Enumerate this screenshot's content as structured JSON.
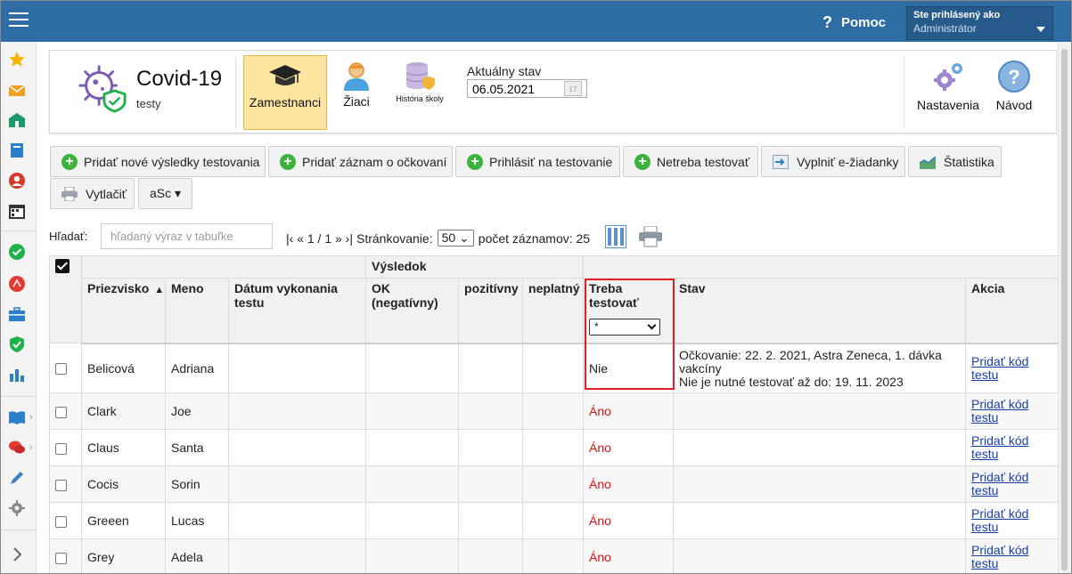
{
  "topbar": {
    "help_label": "Pomoc",
    "user_line1": "Ste prihlásený ako",
    "user_line2": "Administrátor"
  },
  "app": {
    "title": "Covid-19",
    "subtitle": "testy"
  },
  "tabs": [
    {
      "label": "Zamestnanci",
      "active": true
    },
    {
      "label": "Žiaci"
    },
    {
      "label": "História školy"
    }
  ],
  "state": {
    "label": "Aktuálny stav",
    "date": "06.05.2021"
  },
  "header_right": {
    "settings": "Nastavenia",
    "guide": "Návod"
  },
  "toolbar": {
    "add_results": "Pridať nové výsledky testovania",
    "add_vaccination": "Pridať záznam o očkovaní",
    "register_testing": "Prihlásiť na testovanie",
    "no_test_needed": "Netreba testovať",
    "fill_eforms": "Vyplniť e-žiadanky",
    "statistics": "Štatistika",
    "print": "Vytlačiť",
    "asc": "aSc ▾"
  },
  "search": {
    "label": "Hľadať:",
    "placeholder": "hľadaný výraz v tabuľke"
  },
  "pager": {
    "nav": "|‹ « 1 / 1 » ›|",
    "paging_label": "Stránkovanie:",
    "page_size": "50",
    "count_text": "počet záznamov: 25"
  },
  "table": {
    "group_header": "Výsledok",
    "columns": {
      "surname": "Priezvisko",
      "name": "Meno",
      "date": "Dátum vykonania testu",
      "ok": "OK (negatívny)",
      "positive": "pozitívny",
      "invalid": "neplatný",
      "need_test": "Treba testovať",
      "status": "Stav",
      "action": "Akcia"
    },
    "filter_value": "*",
    "rows": [
      {
        "surname": "Belicová",
        "name": "Adriana",
        "need": "Nie",
        "status1": "Očkovanie: 22. 2. 2021, Astra Zeneca, 1. dávka vakcíny",
        "status2": "Nie je nutné testovať až do: 19. 11. 2023",
        "action1": "Pridať kód",
        "action2": "testu"
      },
      {
        "surname": "Clark",
        "name": "Joe",
        "need": "Áno",
        "status1": "",
        "status2": "",
        "action1": "Pridať kód",
        "action2": "testu"
      },
      {
        "surname": "Claus",
        "name": "Santa",
        "need": "Áno",
        "status1": "",
        "status2": "",
        "action1": "Pridať kód",
        "action2": "testu"
      },
      {
        "surname": "Cocis",
        "name": "Sorin",
        "need": "Áno",
        "status1": "",
        "status2": "",
        "action1": "Pridať kód",
        "action2": "testu"
      },
      {
        "surname": "Greeen",
        "name": "Lucas",
        "need": "Áno",
        "status1": "",
        "status2": "",
        "action1": "Pridať kód",
        "action2": "testu"
      },
      {
        "surname": "Grey",
        "name": "Adela",
        "need": "Áno",
        "status1": "",
        "status2": "",
        "action1": "Pridať kód",
        "action2": "testu"
      }
    ]
  },
  "colors": {
    "topbar": "#2e6da4",
    "active_tab": "#fde5a0",
    "yes": "#dd1111",
    "highlight": "#e31e24"
  }
}
